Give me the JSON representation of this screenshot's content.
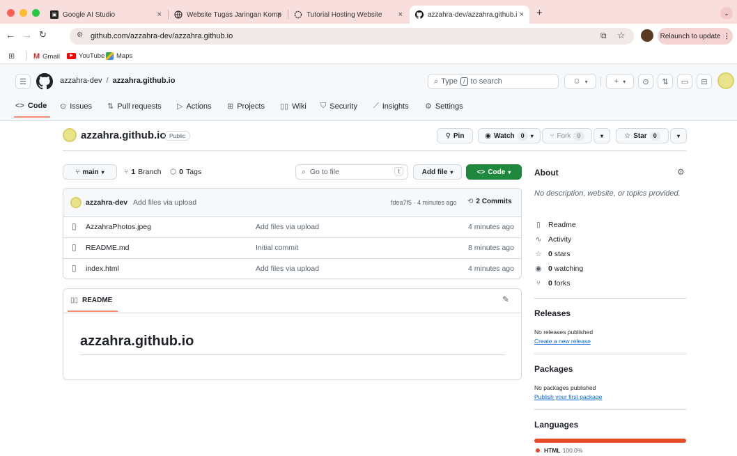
{
  "browser": {
    "tabs": [
      {
        "title": "Google AI Studio",
        "icon": "ai-studio-icon"
      },
      {
        "title": "Website Tugas Jaringan Komp",
        "icon": "globe-icon"
      },
      {
        "title": "Tutorial Hosting Website",
        "icon": "openai-icon"
      },
      {
        "title": "azzahra-dev/azzahra.github.i",
        "icon": "github-icon",
        "active": true
      }
    ],
    "url": "github.com/azzahra-dev/azzahra.github.io",
    "relaunch": "Relaunch to update",
    "bookmarks": [
      "Gmail",
      "YouTube",
      "Maps"
    ]
  },
  "header": {
    "owner": "azzahra-dev",
    "slash": "/",
    "repo": "azzahra.github.io",
    "search_pre": "Type",
    "search_key": "/",
    "search_post": "to search"
  },
  "nav": {
    "tabs": [
      "Code",
      "Issues",
      "Pull requests",
      "Actions",
      "Projects",
      "Wiki",
      "Security",
      "Insights",
      "Settings"
    ]
  },
  "repo": {
    "name": "azzahra.github.io",
    "visibility": "Public",
    "pin": "Pin",
    "watch": "Watch",
    "watch_count": "0",
    "fork": "Fork",
    "fork_count": "0",
    "star": "Star",
    "star_count": "0"
  },
  "toolbar": {
    "branch": "main",
    "branches_count": "1",
    "branches_label": "Branch",
    "tags_count": "0",
    "tags_label": "Tags",
    "goto_placeholder": "Go to file",
    "goto_key": "t",
    "add_file": "Add file",
    "code": "Code"
  },
  "commit": {
    "author": "azzahra-dev",
    "message": "Add files via upload",
    "meta": "fdea7f5 · 4 minutes ago",
    "commits": "2 Commits"
  },
  "files": [
    {
      "name": "AzzahraPhotos.jpeg",
      "message": "Add files via upload",
      "time": "4 minutes ago"
    },
    {
      "name": "README.md",
      "message": "Initial commit",
      "time": "8 minutes ago"
    },
    {
      "name": "index.html",
      "message": "Add files via upload",
      "time": "4 minutes ago"
    }
  ],
  "readme": {
    "tab": "README",
    "heading": "azzahra.github.io"
  },
  "about": {
    "title": "About",
    "description": "No description, website, or topics provided.",
    "readme": "Readme",
    "activity": "Activity",
    "stars_count": "0",
    "stars_label": "stars",
    "watching_count": "0",
    "watching_label": "watching",
    "forks_count": "0",
    "forks_label": "forks"
  },
  "releases": {
    "title": "Releases",
    "none": "No releases published",
    "create": "Create a new release"
  },
  "packages": {
    "title": "Packages",
    "none": "No packages published",
    "publish": "Publish your first package"
  },
  "languages": {
    "title": "Languages",
    "items": [
      {
        "name": "HTML",
        "percent": "100.0%",
        "color": "#e34c26"
      }
    ]
  }
}
